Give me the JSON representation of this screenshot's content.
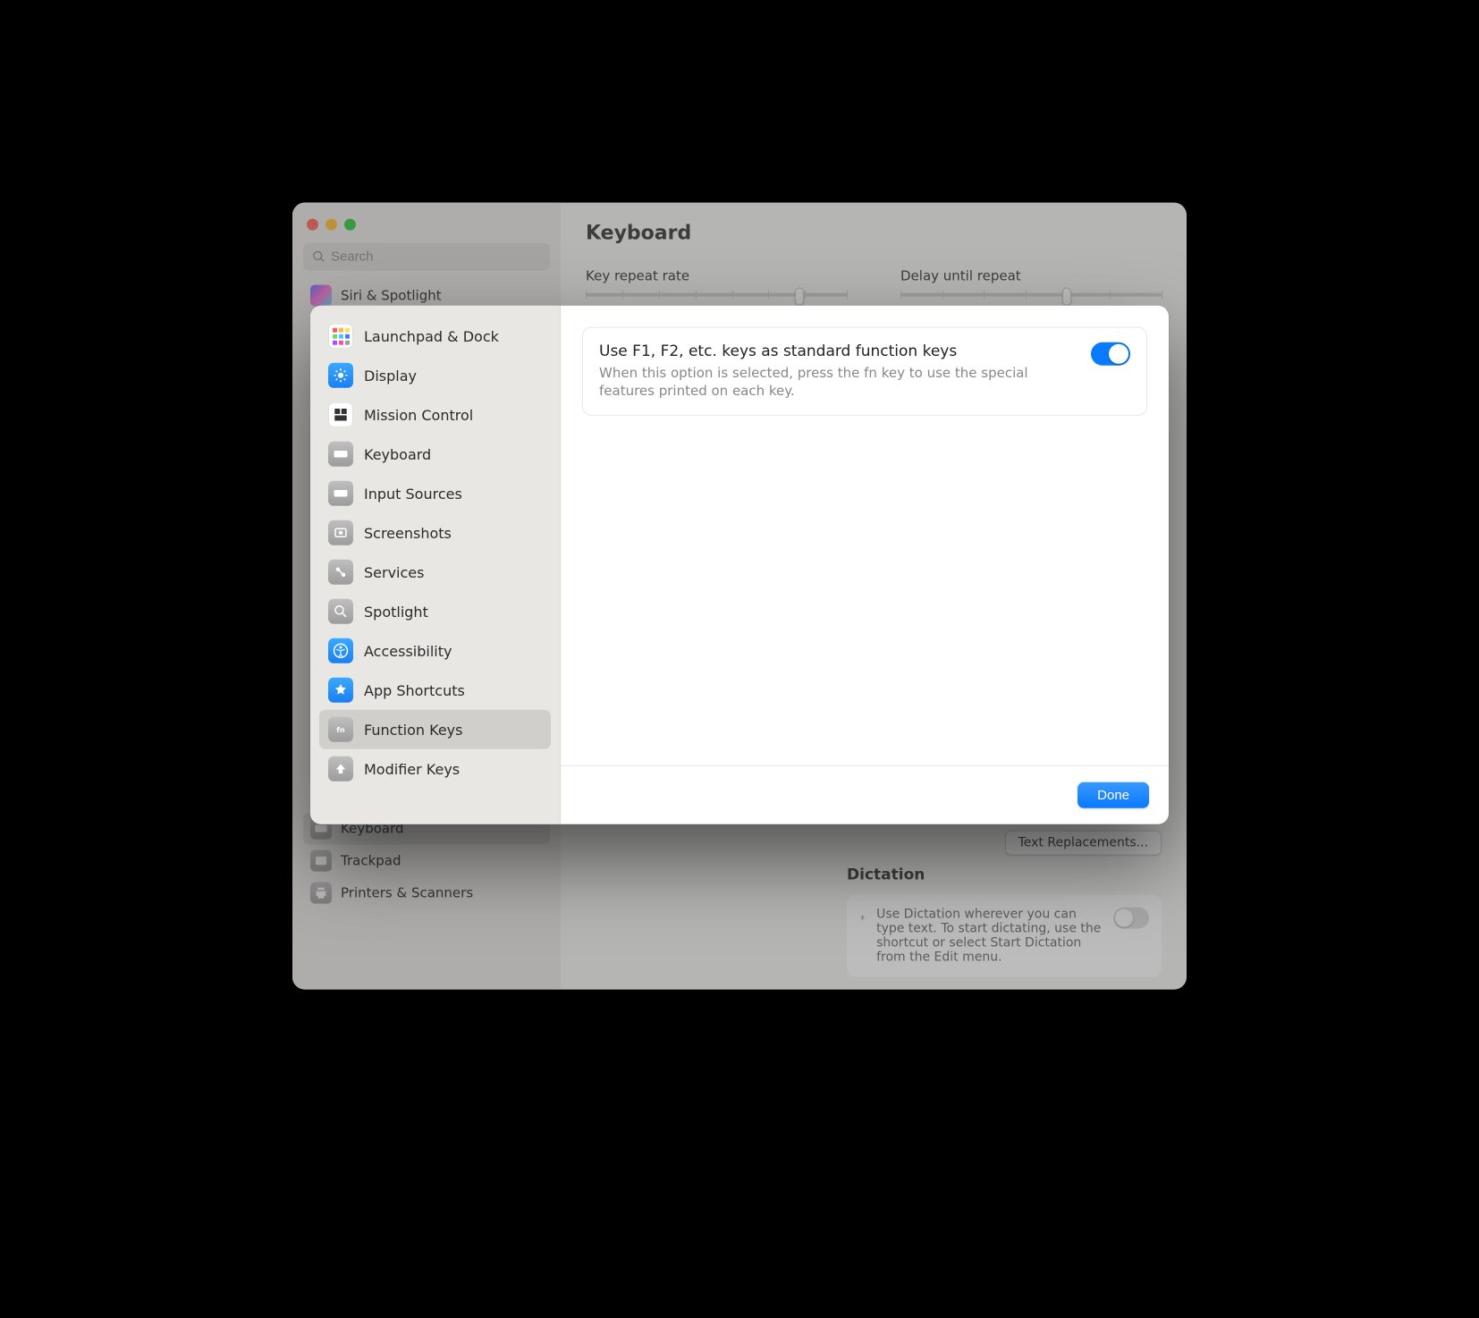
{
  "bg": {
    "search_placeholder": "Search",
    "title": "Keyboard",
    "slider1_label": "Key repeat rate",
    "slider2_label": "Delay until repeat",
    "sidebar_items": [
      {
        "label": "Siri & Spotlight"
      },
      {
        "label": "Keyboard"
      },
      {
        "label": "Trackpad"
      },
      {
        "label": "Printers & Scanners"
      }
    ],
    "text_replacements_btn": "Text Replacements...",
    "dictation_title": "Dictation",
    "dictation_desc": "Use Dictation wherever you can type text. To start dictating, use the shortcut or select Start Dictation from the Edit menu."
  },
  "sheet": {
    "items": [
      {
        "label": "Launchpad & Dock"
      },
      {
        "label": "Display"
      },
      {
        "label": "Mission Control"
      },
      {
        "label": "Keyboard"
      },
      {
        "label": "Input Sources"
      },
      {
        "label": "Screenshots"
      },
      {
        "label": "Services"
      },
      {
        "label": "Spotlight"
      },
      {
        "label": "Accessibility"
      },
      {
        "label": "App Shortcuts"
      },
      {
        "label": "Function Keys"
      },
      {
        "label": "Modifier Keys"
      }
    ],
    "option_title": "Use F1, F2, etc. keys as standard function keys",
    "option_desc": "When this option is selected, press the fn key to use the special features printed on each key.",
    "done_label": "Done"
  }
}
